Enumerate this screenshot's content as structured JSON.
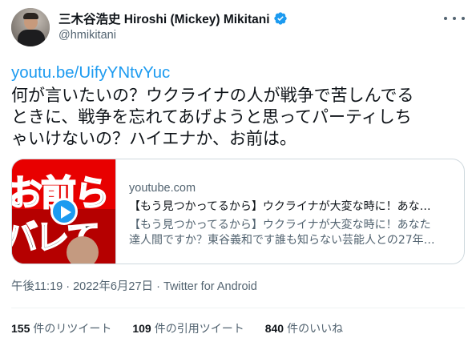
{
  "author": {
    "display_name": "三木谷浩史 Hiroshi (Mickey) Mikitani",
    "handle": "@hmikitani",
    "verified": true
  },
  "tweet": {
    "link": "youtu.be/UifyYNtvYuc",
    "text_lines": [
      "何が言いたいの？ウクライナの人が戦争で苦しんでる",
      "ときに、戦争を忘れてあげようと思ってパーティしち",
      "ゃいけないの？ハイエナか、お前は。"
    ]
  },
  "card": {
    "domain": "youtube.com",
    "title": "【もう見つかってるから】ウクライナが大変な時に！あな…",
    "desc_lines": [
      "【もう見つかってるから】ウクライナが大変な時に！あなた",
      "達人間ですか？東谷義和です誰も知らない芸能人との27年…"
    ],
    "thumb_text_top": "お前ら",
    "thumb_text_bottom": "バレてる"
  },
  "meta": {
    "time": "午後11:19",
    "sep1": " · ",
    "date": "2022年6月27日",
    "sep2": " · ",
    "app": "Twitter for Android"
  },
  "stats": {
    "retweets_count": "155",
    "retweets_label": "件のリツイート",
    "quotes_count": "109",
    "quotes_label": "件の引用ツイート",
    "likes_count": "840",
    "likes_label": "件のいいね"
  },
  "colors": {
    "accent": "#1d9bf0",
    "text": "#0f1419",
    "secondary": "#536471",
    "border": "#cfd9de"
  },
  "icons": {
    "verified": "verified-badge-icon",
    "more": "more-dots-icon",
    "play": "play-icon"
  }
}
